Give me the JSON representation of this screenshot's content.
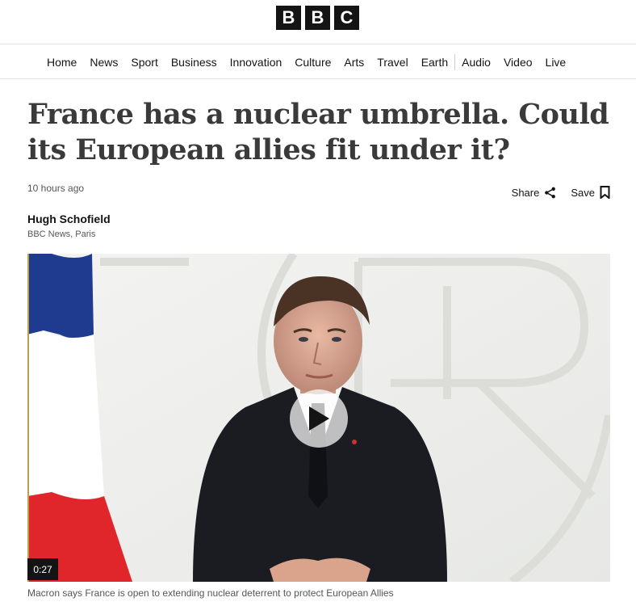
{
  "brand": {
    "letters": [
      "B",
      "B",
      "C"
    ]
  },
  "nav": {
    "primary": [
      "Home",
      "News",
      "Sport",
      "Business",
      "Innovation",
      "Culture",
      "Arts",
      "Travel",
      "Earth"
    ],
    "secondary": [
      "Audio",
      "Video",
      "Live"
    ]
  },
  "article": {
    "headline": "France has a nuclear umbrella. Could its European allies fit under it?",
    "timestamp": "10 hours ago",
    "share_label": "Share",
    "save_label": "Save",
    "author_name": "Hugh Schofield",
    "author_role": "BBC News, Paris"
  },
  "media": {
    "duration": "0:27",
    "caption": "Macron says France is open to extending nuclear deterrent to protect European Allies"
  },
  "colors": {
    "text": "#141414",
    "muted": "#545658",
    "flag_blue": "#1f3b8f",
    "flag_red": "#e0252b"
  },
  "icons": [
    "share-icon",
    "bookmark-icon",
    "play-icon"
  ]
}
